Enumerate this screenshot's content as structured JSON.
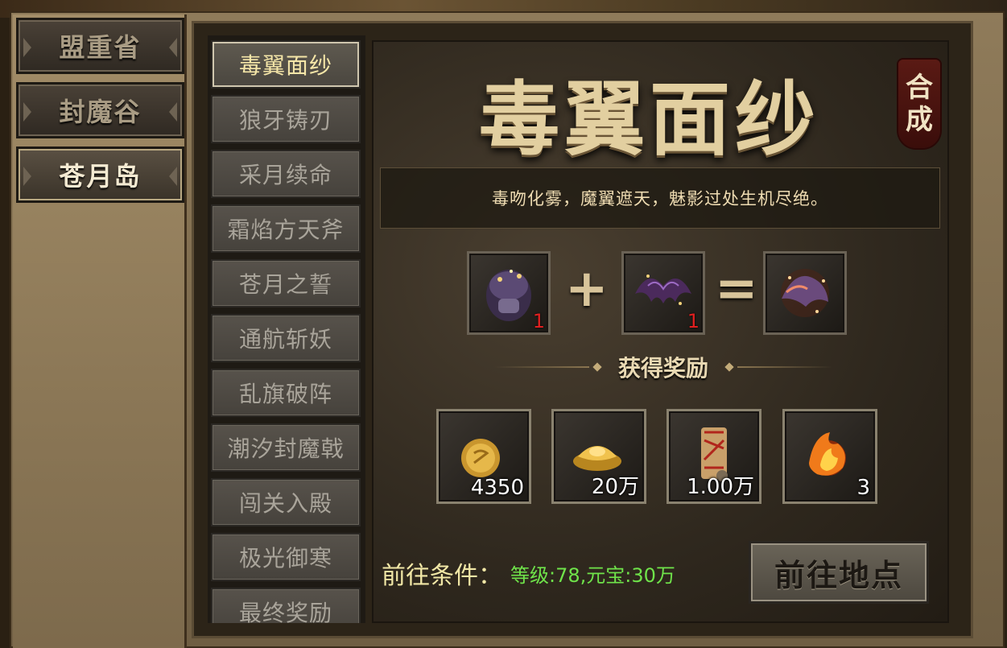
{
  "regions": [
    {
      "label": "盟重省",
      "active": false
    },
    {
      "label": "封魔谷",
      "active": false
    },
    {
      "label": "苍月岛",
      "active": true
    }
  ],
  "quests": [
    {
      "label": "毒翼面纱",
      "active": true
    },
    {
      "label": "狼牙铸刃",
      "active": false
    },
    {
      "label": "采月续命",
      "active": false
    },
    {
      "label": "霜焰方天斧",
      "active": false
    },
    {
      "label": "苍月之誓",
      "active": false
    },
    {
      "label": "通航斩妖",
      "active": false
    },
    {
      "label": "乱旗破阵",
      "active": false
    },
    {
      "label": "潮汐封魔戟",
      "active": false
    },
    {
      "label": "闯关入殿",
      "active": false
    },
    {
      "label": "极光御寒",
      "active": false
    },
    {
      "label": "最终奖励",
      "active": false
    }
  ],
  "detail": {
    "title": "毒翼面纱",
    "synth_button": [
      "合",
      "成"
    ],
    "description": "毒吻化雾，魔翼遮天，魅影过处生机尽绝。",
    "recipe": {
      "material_1": {
        "icon": "dark-helmet-icon",
        "count": "1"
      },
      "plus": "+",
      "material_2": {
        "icon": "bat-wing-icon",
        "count": "1"
      },
      "equals": "=",
      "result": {
        "icon": "winged-mask-icon"
      }
    },
    "rewards_label": "获得奖励",
    "rewards": [
      {
        "icon": "gold-coin-icon",
        "count": "4350"
      },
      {
        "icon": "gold-ingot-icon",
        "count": "20万"
      },
      {
        "icon": "scroll-icon",
        "count": "1.00万"
      },
      {
        "icon": "fire-orb-icon",
        "count": "3"
      }
    ],
    "condition_label": "前往条件：",
    "condition_value": "等级:78,元宝:30万",
    "go_button": "前往地点"
  },
  "colors": {
    "highlight_text": "#f5e6a8",
    "condition_value": "#6fe34a",
    "count_red": "#e02020"
  }
}
